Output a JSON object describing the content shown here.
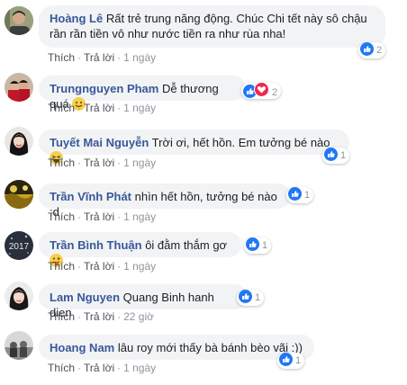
{
  "actions": {
    "like": "Thích",
    "reply": "Trả lời",
    "sep": "·"
  },
  "comments": [
    {
      "name": "Hoàng Lê",
      "text": "Rất trẻ trung năng động. Chúc Chi tết này sô chậu",
      "text2": "rần rần tiền vô như nước tiền ra như rùa nha!",
      "time": "1 ngày",
      "reactions": [
        "like"
      ],
      "count": "2"
    },
    {
      "name": "Trungnguyen Pham",
      "text": "Dễ thương quá",
      "emoji": "smile",
      "time": "1 ngày",
      "reactions": [
        "like",
        "love"
      ],
      "count": "2"
    },
    {
      "name": "Tuyết Mai Nguyễn",
      "text": "Trời ơi, hết hồn. Em tưởng bé nào",
      "emoji": "laugh",
      "time": "1 ngày",
      "reactions": [
        "like"
      ],
      "count": "1"
    },
    {
      "name": "Trần Vĩnh Phát",
      "text": "nhìn hết hồn, tưởng bé nào :d",
      "time": "1 ngày",
      "reactions": [
        "like"
      ],
      "count": "1"
    },
    {
      "name": "Trần Bình Thuận",
      "text": "ôi đằm thắm gơ",
      "emoji": "tongue",
      "time": "1 ngày",
      "reactions": [
        "like"
      ],
      "count": "1"
    },
    {
      "name": "Lam Nguyen",
      "text": "Quang Binh hanh dien",
      "time": "22 giờ",
      "reactions": [
        "like"
      ],
      "count": "1"
    },
    {
      "name": "Hoang Nam",
      "text": "lâu roy mới thấy bà bánh bèo vãi :))",
      "time": "1 ngày",
      "reactions": [
        "like"
      ],
      "count": "1"
    }
  ],
  "avatar_texts": {
    "c4": "2017"
  },
  "colors": {
    "name": "#385898",
    "bubble": "#f2f3f5",
    "like": "#2078f4",
    "love": "#f0284a",
    "meta": "#90949c"
  }
}
